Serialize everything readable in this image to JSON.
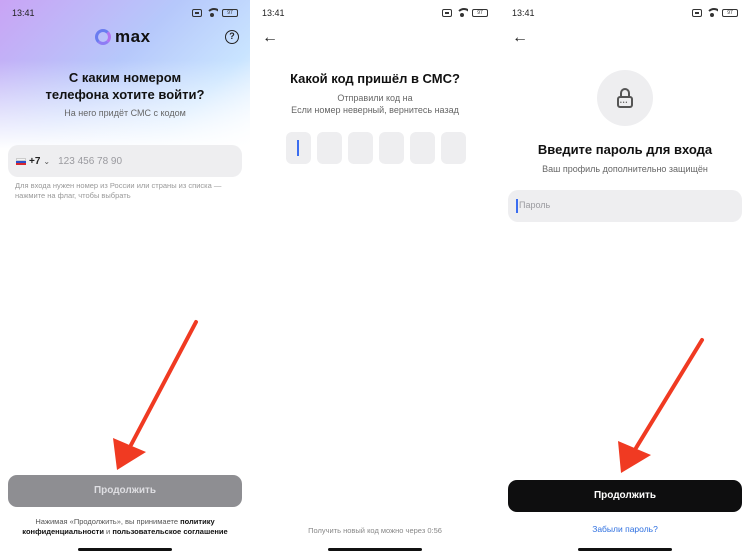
{
  "colors": {
    "arrow": "#f03a22",
    "link": "#2d6fe0",
    "primary_button": "#0e0e0f",
    "disabled_button": "#8e8e92",
    "field_bg": "#eeeef0"
  },
  "status": {
    "time": "13:41",
    "battery": "97"
  },
  "screen1": {
    "logo_text": "max",
    "title_line1": "С каким номером",
    "title_line2": "телефона хотите войти?",
    "subtitle": "На него придёт СМС с кодом",
    "country_code": "+7",
    "phone_placeholder": "123 456 78 90",
    "hint": "Для входа нужен номер из России или страны из списка — нажмите на флаг, чтобы выбрать",
    "continue_label": "Продолжить",
    "legal_prefix": "Нажимая «Продолжить», вы принимаете",
    "legal_policy": "политику конфиденциальности",
    "legal_and": "и",
    "legal_agreement": "пользовательское соглашение"
  },
  "screen2": {
    "title": "Какой код пришёл в СМС?",
    "sent_to": "Отправили код на",
    "wrong_number": "Если номер неверный, вернитесь назад",
    "resend": "Получить новый код можно через 0:56"
  },
  "screen3": {
    "title": "Введите пароль для входа",
    "subtitle": "Ваш профиль дополнительно защищён",
    "password_placeholder": "Пароль",
    "continue_label": "Продолжить",
    "forgot_label": "Забыли пароль?"
  }
}
